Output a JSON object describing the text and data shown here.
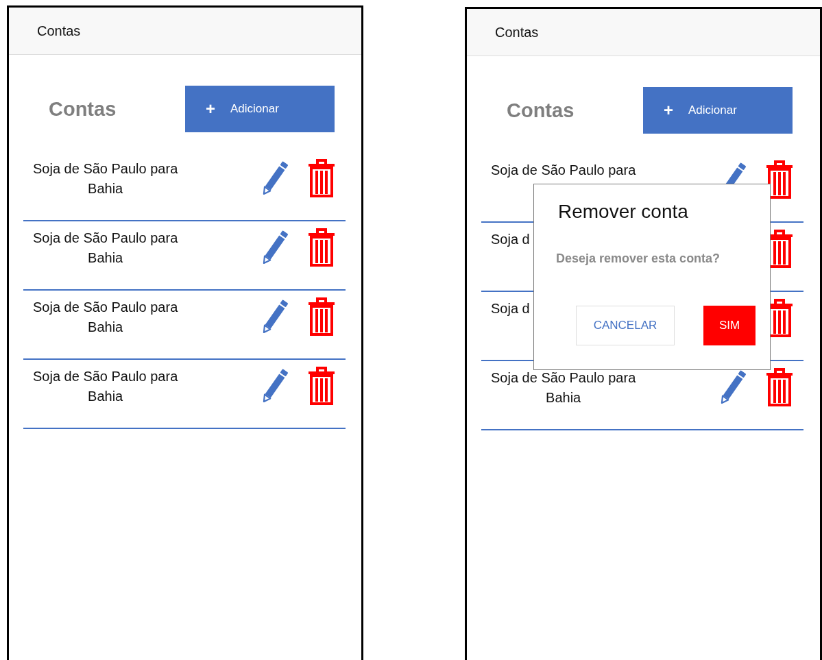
{
  "screens": [
    {
      "app_bar": {
        "title": "Contas"
      },
      "heading": "Contas",
      "add_button": {
        "icon": "+",
        "label": "Adicionar"
      },
      "rows": [
        {
          "lines": [
            "Soja de São Paulo para",
            "Bahia"
          ],
          "edit_icon": true
        },
        {
          "lines": [
            "Soja de São Paulo para",
            "Bahia"
          ],
          "edit_icon": true
        },
        {
          "lines": [
            "Soja de São Paulo para",
            "Bahia"
          ],
          "edit_icon": true
        },
        {
          "lines": [
            "Soja de São Paulo para",
            "Bahia"
          ],
          "edit_icon": true
        }
      ]
    },
    {
      "app_bar": {
        "title": "Contas"
      },
      "heading": "Contas",
      "add_button": {
        "icon": "+",
        "label": "Adicionar"
      },
      "rows": [
        {
          "lines": [
            "Soja de São Paulo para"
          ],
          "edit_icon": true
        },
        {
          "lines": [
            "Soja d"
          ],
          "edit_icon": false
        },
        {
          "lines": [
            "Soja d"
          ],
          "edit_icon": false
        },
        {
          "lines": [
            "Soja de São Paulo para",
            "Bahia"
          ],
          "edit_icon": true
        }
      ],
      "dialog": {
        "title": "Remover conta",
        "message": "Deseja remover esta conta?",
        "buttons": [
          {
            "label": "CANCELAR",
            "kind": "secondary"
          },
          {
            "label": "SIM",
            "kind": "danger"
          }
        ]
      }
    }
  ]
}
